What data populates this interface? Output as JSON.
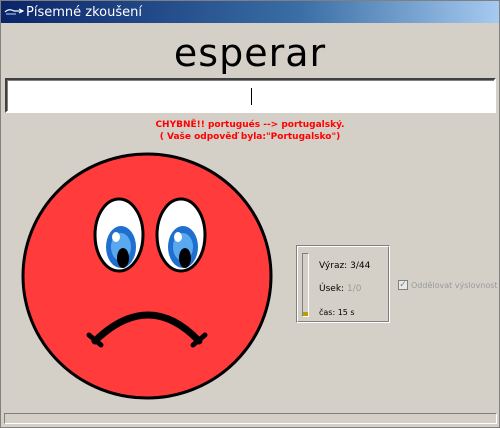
{
  "window": {
    "title": "Písemné zkoušení"
  },
  "prompt_word": "esperar",
  "answer_input": {
    "value": ""
  },
  "feedback": {
    "line1": "CHYBNĚ!! portugués --> portugalský.",
    "line2": "( Vaše odpověď byla:\"Portugalsko\")"
  },
  "stats": {
    "vyraz_label": "Výraz:",
    "vyraz_value": "3/44",
    "usek_label": "Úsek:",
    "usek_value": "1/0",
    "cas": "čas: 15 s",
    "progress_fraction": 0.06
  },
  "options": {
    "separate_pronunciation_label": "Oddělovat výslovnost",
    "separate_pronunciation_checked": true,
    "enabled": false
  },
  "icons": {
    "title": "arrow-icon",
    "face": "sad-face-icon"
  },
  "colors": {
    "face_fill": "#ff3b3b",
    "feedback_text": "#ff0000",
    "eye_iris": "#1f6fd0"
  }
}
